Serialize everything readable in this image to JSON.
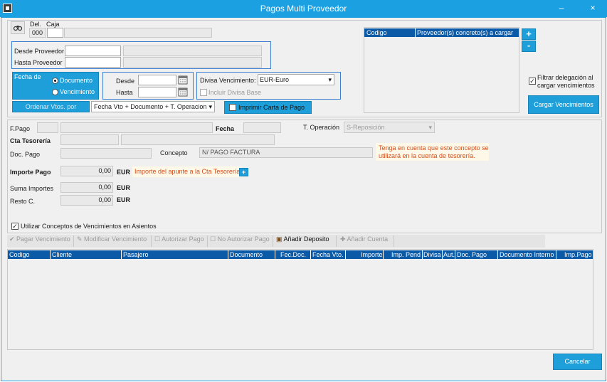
{
  "window": {
    "title": "Pagos Multi Proveedor",
    "minimize": "–",
    "close": "×"
  },
  "header": {
    "del_label": "Del.",
    "caja_label": "Caja",
    "del_value": "000",
    "caja_value": "",
    "caja_desc": ""
  },
  "proveedor": {
    "desde_label": "Desde Proveedor",
    "hasta_label": "Hasta Proveedor"
  },
  "fecha_de": {
    "label": "Fecha de",
    "options": [
      "Documento",
      "Vencimiento"
    ],
    "selected": "Documento"
  },
  "rango": {
    "desde_label": "Desde",
    "hasta_label": "Hasta"
  },
  "divisa": {
    "label": "Divisa Vencimiento:",
    "value": "EUR-Euro",
    "incluir_label": "Incluir Divisa Base"
  },
  "ordenar": {
    "label": "Ordenar Vtos. por",
    "value": "Fecha Vto + Documento + T. Operacion"
  },
  "imprimir": {
    "label": "Imprimir Carta de Pago"
  },
  "proveedores_table": {
    "columns": [
      "Codigo",
      "Proveedor(s) concreto(s) a cargar"
    ],
    "add": "+",
    "remove": "-"
  },
  "filtrar": {
    "label": "Filtrar delegación al cargar vencimientos",
    "line1": "Filtrar delegación al",
    "line2": "cargar vencimientos",
    "checked": true
  },
  "cargar_button": "Cargar Vencimientos",
  "pago": {
    "fpago_label": "F.Pago",
    "fecha_label": "Fecha",
    "toperacion_label": "T. Operación",
    "toperacion_value": "S-Reposición",
    "cta_label": "Cta Tesorería",
    "docpago_label": "Doc. Pago",
    "concepto_label": "Concepto",
    "concepto_value": "N/ PAGO FACTURA",
    "concepto_note": "Tenga en cuenta que este concepto se utilizará en la cuenta de tesorería.",
    "concepto_note_1": "Tenga en cuenta que este concepto se",
    "concepto_note_2": "utilizará en la cuenta de tesorería.",
    "importe_label": "Importe Pago",
    "importe_value": "0,00",
    "currency": "EUR",
    "importe_note": "Importe del apunte a la Cta Tesorería",
    "importe_add": "+",
    "suma_label": "Suma Importes",
    "suma_value": "0,00",
    "resto_label": "Resto C.",
    "resto_value": "0,00"
  },
  "utilizar": {
    "label": "Utilizar Conceptos de Vencimientos en Asientos",
    "checked": true
  },
  "toolbar": {
    "pagar": "Pagar Vencimiento",
    "modificar": "Modificar Vencimiento",
    "autorizar": "Autorizar Pago",
    "no_autorizar": "No Autorizar Pago",
    "anadir_deposito": "Añadir Deposito",
    "anadir_cuenta": "Añadir Cuenta"
  },
  "main_table": {
    "columns": [
      "Codigo",
      "Cliente",
      "Pasajero",
      "Documento",
      "Fec.Doc.",
      "Fecha Vto.",
      "Importe",
      "Imp. Pend",
      "Divisa",
      "Aut.",
      "Doc. Pago",
      "Documento Interno",
      "Imp.Pago"
    ]
  },
  "cancel_button": "Cancelar",
  "icons": {
    "app": "app-icon",
    "binoculars": "binoculars-icon",
    "calendar": "calendar-icon",
    "check": "check-icon",
    "deposit": "deposit-icon",
    "plus": "plus-icon"
  },
  "colors": {
    "title_bar": "#1ba1e2",
    "table_header": "#0b5aa8",
    "button": "#1e9fd9",
    "note": "#d24d1a"
  }
}
